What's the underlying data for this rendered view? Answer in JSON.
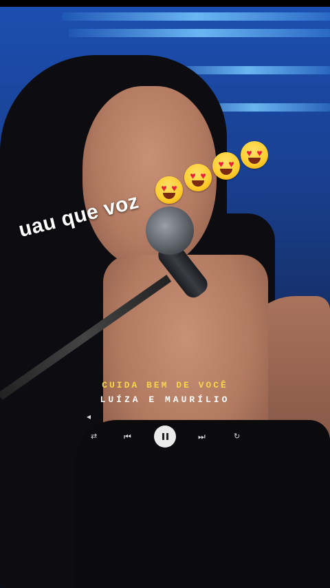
{
  "overlay": {
    "caption": "uau que voz",
    "emoji_name": "smiling-face-with-heart-eyes"
  },
  "player": {
    "song_title": "CUIDA BEM DE VOCÊ",
    "artist": "LUÍZA E MAURÍLIO",
    "state": "playing",
    "controls": [
      "volume-icon",
      "shuffle-icon",
      "previous-icon",
      "pause-icon",
      "next-icon",
      "repeat-icon"
    ]
  },
  "colors": {
    "title_yellow": "#f4d64a",
    "stage_blue": "#1b4fb0"
  }
}
